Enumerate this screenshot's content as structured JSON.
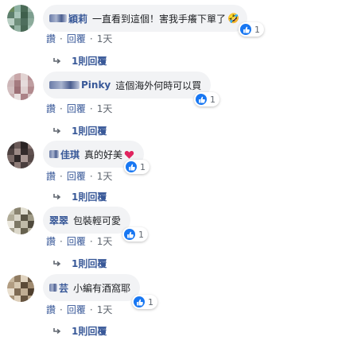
{
  "comments": [
    {
      "name": "穎莉",
      "text": "一直看到這個！害我手癢下單了",
      "emoji": "🤣",
      "likes": "1",
      "like_label": "讚",
      "reply_label": "回覆",
      "time": "1天",
      "replies_label": "1則回覆",
      "avatar_colors": [
        "#6a8a5e",
        "#8fb2a4",
        "#4a6b57",
        "#9eb7aa",
        "#5d7f6c",
        "#a7c4b8",
        "#3f5f4c",
        "#7d9e8f",
        "#b9cfc4",
        "#6f8f7b",
        "#4e6e5d",
        "#8cab9b",
        "#5a7a66",
        "#93b2a2",
        "#486855",
        "#a0bdb0"
      ]
    },
    {
      "name": "Pinky",
      "text": "這個海外何時可以買",
      "emoji": "",
      "likes": "",
      "like_label": "讚",
      "reply_label": "回覆",
      "time": "1天",
      "replies_label": "1則回覆",
      "avatar_colors": [
        "#d8c8c8",
        "#c9a7a9",
        "#e2d4d3",
        "#b68f93",
        "#cdb6b8",
        "#a57b80",
        "#e6dcdc",
        "#bf9ea1",
        "#d3bfc0",
        "#9c7076",
        "#dfd0d0",
        "#b28a8e",
        "#c7adaf",
        "#e9e1e1",
        "#ab8287",
        "#d6c4c5"
      ]
    },
    {
      "name": "佳琪",
      "text": "真的好美",
      "emoji": "❤️",
      "likes": "1",
      "like_label": "讚",
      "reply_label": "回覆",
      "time": "1天",
      "replies_label": "1則回覆",
      "avatar_colors": [
        "#3a3333",
        "#6a5a58",
        "#2a2424",
        "#857370",
        "#4d4140",
        "#9b8985",
        "#332b2b",
        "#5f504e",
        "#7a6a67",
        "#2e2727",
        "#a89692",
        "#554846",
        "#3f3535",
        "#8f7d79",
        "#4a3f3e",
        "#6f605d"
      ]
    },
    {
      "name": "翠翠",
      "text": "包裝輕可愛",
      "emoji": "",
      "likes": "1",
      "like_label": "讚",
      "reply_label": "回覆",
      "time": "1天",
      "replies_label": "1則回覆",
      "avatar_colors": [
        "#c9c6b5",
        "#8a8470",
        "#e2dfd2",
        "#6f6a58",
        "#b0ab97",
        "#d8d4c6",
        "#5c5747",
        "#9f9a86",
        "#ebe8de",
        "#7d7865",
        "#c0bba8",
        "#4f4a3c",
        "#a8a390",
        "#dcd8ca",
        "#67624f",
        "#b8b3a0"
      ]
    },
    {
      "name": "芸",
      "text": "小編有酒窩耶",
      "emoji": "",
      "likes": "1",
      "like_label": "讚",
      "reply_label": "回覆",
      "time": "1天",
      "replies_label": "1則回覆",
      "avatar_colors": [
        "#c8b79e",
        "#8f7b62",
        "#e0d3bf",
        "#6d5b46",
        "#b19c81",
        "#d6c7b0",
        "#5b4a37",
        "#a08b70",
        "#e9dfcf",
        "#7e6a53",
        "#c0ad93",
        "#4f3f2e",
        "#a99479",
        "#ddcfba",
        "#66543f",
        "#b8a58b"
      ]
    }
  ],
  "colors": {
    "link": "#385898",
    "muted": "#606770",
    "bubble": "#f2f3f5",
    "like_blue": "#1877f2"
  },
  "icons": {
    "like": "thumbs-up-icon",
    "reply": "reply-arrow-icon"
  }
}
